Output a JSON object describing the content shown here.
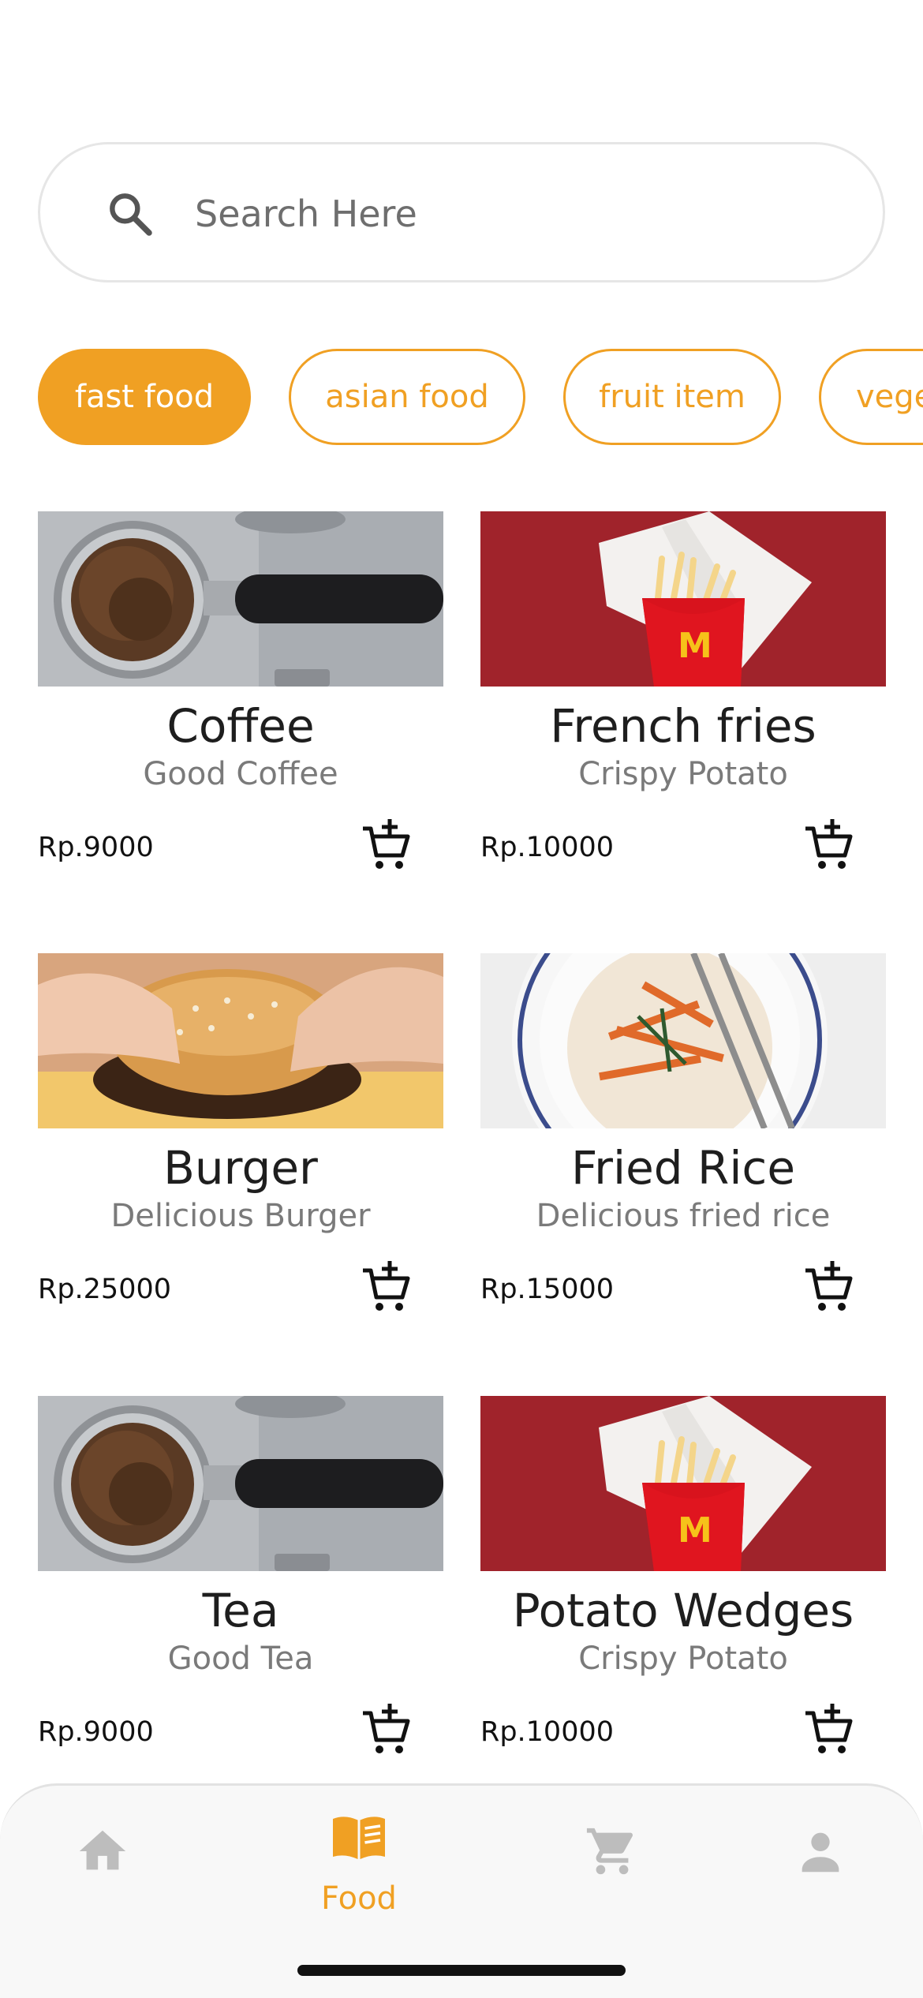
{
  "search": {
    "placeholder": "Search Here",
    "icon": "search-icon"
  },
  "categories": [
    {
      "label": "fast food",
      "active": true
    },
    {
      "label": "asian food",
      "active": false
    },
    {
      "label": "fruit item",
      "active": false
    },
    {
      "label": "vegetables",
      "active": false
    }
  ],
  "items": [
    {
      "title": "Coffee",
      "description": "Good Coffee",
      "price": "Rp.9000",
      "image": "coffee-image"
    },
    {
      "title": "French fries",
      "description": "Crispy Potato",
      "price": "Rp.10000",
      "image": "fries-image"
    },
    {
      "title": "Burger",
      "description": "Delicious Burger",
      "price": "Rp.25000",
      "image": "burger-image"
    },
    {
      "title": "Fried Rice",
      "description": "Delicious fried rice",
      "price": "Rp.15000",
      "image": "fried-rice-image"
    },
    {
      "title": "Tea",
      "description": "Good Tea",
      "price": "Rp.9000",
      "image": "coffee-image"
    },
    {
      "title": "Potato Wedges",
      "description": "Crispy Potato",
      "price": "Rp.10000",
      "image": "fries-image"
    }
  ],
  "nav": {
    "items": [
      {
        "icon": "home-icon",
        "label": ""
      },
      {
        "icon": "menu-book-icon",
        "label": "Food",
        "active": true
      },
      {
        "icon": "cart-icon",
        "label": ""
      },
      {
        "icon": "person-icon",
        "label": ""
      }
    ]
  },
  "colors": {
    "accent": "#f0a023",
    "inactive_icon": "#bdbdbd",
    "text": "#1e1e1e",
    "muted": "#7a7a7a"
  }
}
